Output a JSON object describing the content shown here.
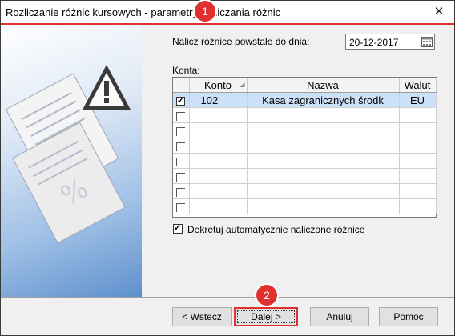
{
  "window": {
    "title": "Rozliczanie różnic kursowych - parametry rozliczania różnic",
    "close_symbol": "✕"
  },
  "form": {
    "date_label": "Nalicz różnice powstałe do dnia:",
    "date_value": "20-12-2017",
    "accounts_label": "Konta:"
  },
  "accounts_table": {
    "headers": [
      "Konto",
      "Nazwa",
      "Walut"
    ],
    "rows": [
      {
        "checked": true,
        "konto": "102",
        "nazwa": "Kasa zagranicznych środk",
        "waluta": "EU"
      },
      {
        "checked": false,
        "konto": "",
        "nazwa": "",
        "waluta": ""
      },
      {
        "checked": false,
        "konto": "",
        "nazwa": "",
        "waluta": ""
      },
      {
        "checked": false,
        "konto": "",
        "nazwa": "",
        "waluta": ""
      },
      {
        "checked": false,
        "konto": "",
        "nazwa": "",
        "waluta": ""
      },
      {
        "checked": false,
        "konto": "",
        "nazwa": "",
        "waluta": ""
      },
      {
        "checked": false,
        "konto": "",
        "nazwa": "",
        "waluta": ""
      },
      {
        "checked": false,
        "konto": "",
        "nazwa": "",
        "waluta": ""
      }
    ]
  },
  "options": {
    "auto_decree_label": "Dekretuj automatycznie naliczone różnice",
    "auto_decree_checked": true
  },
  "buttons": {
    "back": "< Wstecz",
    "next": "Dalej >",
    "cancel": "Anuluj",
    "help": "Pomoc"
  },
  "annotations": {
    "badge1": "1",
    "badge2": "2"
  },
  "colors": {
    "accent": "#e0302f",
    "selection": "#cce0f7",
    "panel_blue": "#5f90cc"
  },
  "icons": {
    "close": "close-icon",
    "calendar": "calendar-icon",
    "warning": "warning-icon",
    "documents": "documents-icon"
  }
}
